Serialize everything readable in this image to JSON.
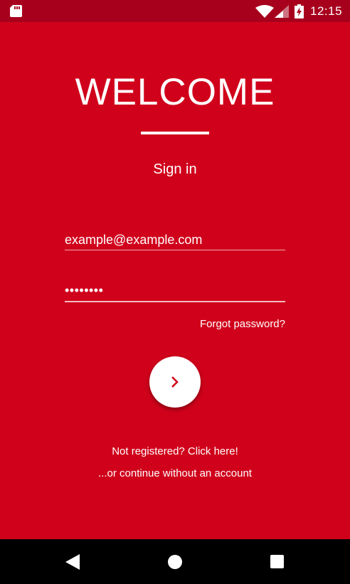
{
  "status_bar": {
    "time": "12:15",
    "icons": [
      "sd-card-icon",
      "wifi-icon",
      "cell-signal-icon",
      "battery-charging-icon"
    ]
  },
  "login": {
    "title": "WELCOME",
    "subtitle": "Sign in",
    "email_value": "example@example.com",
    "password_value": "••••••••",
    "forgot_label": "Forgot password?",
    "submit_icon": "chevron-right-icon",
    "register_label": "Not registered? Click here!",
    "continue_label": "...or continue without an account"
  },
  "nav_bar": {
    "icons": [
      "back-icon",
      "home-icon",
      "recents-icon"
    ]
  },
  "colors": {
    "background": "#D0021B",
    "status_bar": "#A7001D",
    "text": "#FFFFFF",
    "fab": "#FFFFFF",
    "fab_icon": "#D0021B",
    "nav_bar": "#000000"
  }
}
